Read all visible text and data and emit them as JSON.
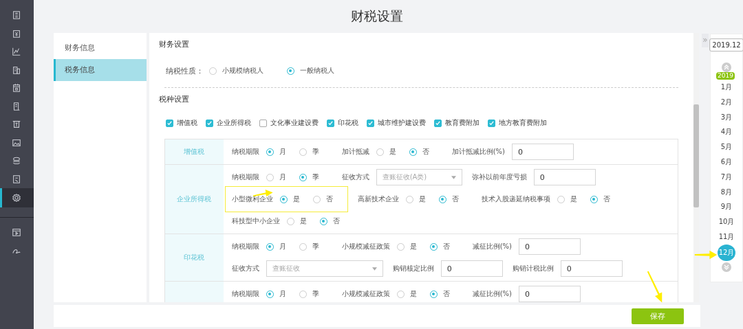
{
  "page_title": "财税设置",
  "sidebar": {
    "items": [
      {
        "selected": false
      },
      {
        "selected": false
      },
      {
        "selected": false
      },
      {
        "selected": false
      },
      {
        "selected": false
      },
      {
        "selected": false
      },
      {
        "selected": false
      },
      {
        "selected": false
      },
      {
        "selected": false
      },
      {
        "selected": false
      },
      {
        "selected": true
      },
      {
        "selected": false
      },
      {
        "selected": false
      }
    ]
  },
  "nav": [
    {
      "label": "财务信息",
      "selected": false
    },
    {
      "label": "税务信息",
      "selected": true
    }
  ],
  "finance": {
    "title": "财务设置",
    "taxpayer": {
      "label": "纳税性质：",
      "options": [
        {
          "label": "小规模纳税人",
          "selected": false
        },
        {
          "label": "一般纳税人",
          "selected": true
        }
      ]
    }
  },
  "tax_types": {
    "title": "税种设置",
    "items": [
      {
        "label": "增值税",
        "checked": true
      },
      {
        "label": "企业所得税",
        "checked": true
      },
      {
        "label": "文化事业建设费",
        "checked": false
      },
      {
        "label": "印花税",
        "checked": true
      },
      {
        "label": "城市维护建设费",
        "checked": true
      },
      {
        "label": "教育费附加",
        "checked": true
      },
      {
        "label": "地方教育费附加",
        "checked": true
      }
    ]
  },
  "table": {
    "rows": [
      {
        "tax": "增值税",
        "lines": [
          [
            {
              "kind": "radio",
              "label": "纳税期限",
              "options": [
                {
                  "label": "月",
                  "selected": true
                },
                {
                  "label": "季",
                  "selected": false
                }
              ]
            },
            {
              "kind": "radio",
              "label": "加计抵减",
              "options": [
                {
                  "label": "是",
                  "selected": false
                },
                {
                  "label": "否",
                  "selected": true
                }
              ]
            },
            {
              "kind": "field",
              "label": "加计抵减比例(%)",
              "value": "0"
            }
          ]
        ]
      },
      {
        "tax": "企业所得税",
        "lines": [
          [
            {
              "kind": "radio",
              "label": "纳税期限",
              "options": [
                {
                  "label": "月",
                  "selected": false
                },
                {
                  "label": "季",
                  "selected": true
                }
              ]
            },
            {
              "kind": "select",
              "label": "征收方式",
              "value": "查账征收(A类)"
            },
            {
              "kind": "field",
              "label": "弥补以前年度亏损",
              "value": "0"
            }
          ],
          [
            {
              "kind": "radio",
              "label": "小型微利企业",
              "highlighted": true,
              "options": [
                {
                  "label": "是",
                  "selected": true
                },
                {
                  "label": "否",
                  "selected": false
                }
              ]
            },
            {
              "kind": "radio",
              "label": "高新技术企业",
              "options": [
                {
                  "label": "是",
                  "selected": false
                },
                {
                  "label": "否",
                  "selected": true
                }
              ]
            },
            {
              "kind": "radio",
              "label": "技术入股递延纳税事项",
              "options": [
                {
                  "label": "是",
                  "selected": false
                },
                {
                  "label": "否",
                  "selected": true
                }
              ]
            }
          ],
          [
            {
              "kind": "radio",
              "label": "科技型中小企业",
              "options": [
                {
                  "label": "是",
                  "selected": false
                },
                {
                  "label": "否",
                  "selected": true
                }
              ]
            }
          ]
        ]
      },
      {
        "tax": "印花税",
        "lines": [
          [
            {
              "kind": "radio",
              "label": "纳税期限",
              "options": [
                {
                  "label": "月",
                  "selected": true
                },
                {
                  "label": "季",
                  "selected": false
                }
              ]
            },
            {
              "kind": "radio",
              "label": "小规模减征政策",
              "options": [
                {
                  "label": "是",
                  "selected": false
                },
                {
                  "label": "否",
                  "selected": true
                }
              ]
            },
            {
              "kind": "field",
              "label": "减征比例(%)",
              "value": "0"
            }
          ],
          [
            {
              "kind": "select",
              "label": "征收方式",
              "value": "查账征收"
            },
            {
              "kind": "field",
              "label": "购销核定比例",
              "value": "0"
            },
            {
              "kind": "field",
              "label": "购销计税比例",
              "value": "0"
            }
          ]
        ]
      },
      {
        "tax": "",
        "lines": [
          [
            {
              "kind": "radio",
              "label": "纳税期限",
              "options": [
                {
                  "label": "月",
                  "selected": true
                },
                {
                  "label": "季",
                  "selected": false
                }
              ]
            },
            {
              "kind": "radio",
              "label": "小规模减征政策",
              "options": [
                {
                  "label": "是",
                  "selected": false
                },
                {
                  "label": "否",
                  "selected": true
                }
              ]
            },
            {
              "kind": "field",
              "label": "减征比例(%)",
              "value": "0"
            }
          ]
        ]
      }
    ]
  },
  "save_button": "保存",
  "period": {
    "current": "2019.12",
    "expand": "»",
    "year": "2019",
    "months": [
      {
        "label": "1月",
        "selected": false
      },
      {
        "label": "2月",
        "selected": false
      },
      {
        "label": "3月",
        "selected": false
      },
      {
        "label": "4月",
        "selected": false
      },
      {
        "label": "5月",
        "selected": false
      },
      {
        "label": "6月",
        "selected": false
      },
      {
        "label": "7月",
        "selected": false
      },
      {
        "label": "8月",
        "selected": false
      },
      {
        "label": "9月",
        "selected": false
      },
      {
        "label": "10月",
        "selected": false
      },
      {
        "label": "11月",
        "selected": false
      },
      {
        "label": "12月",
        "selected": true
      }
    ]
  }
}
